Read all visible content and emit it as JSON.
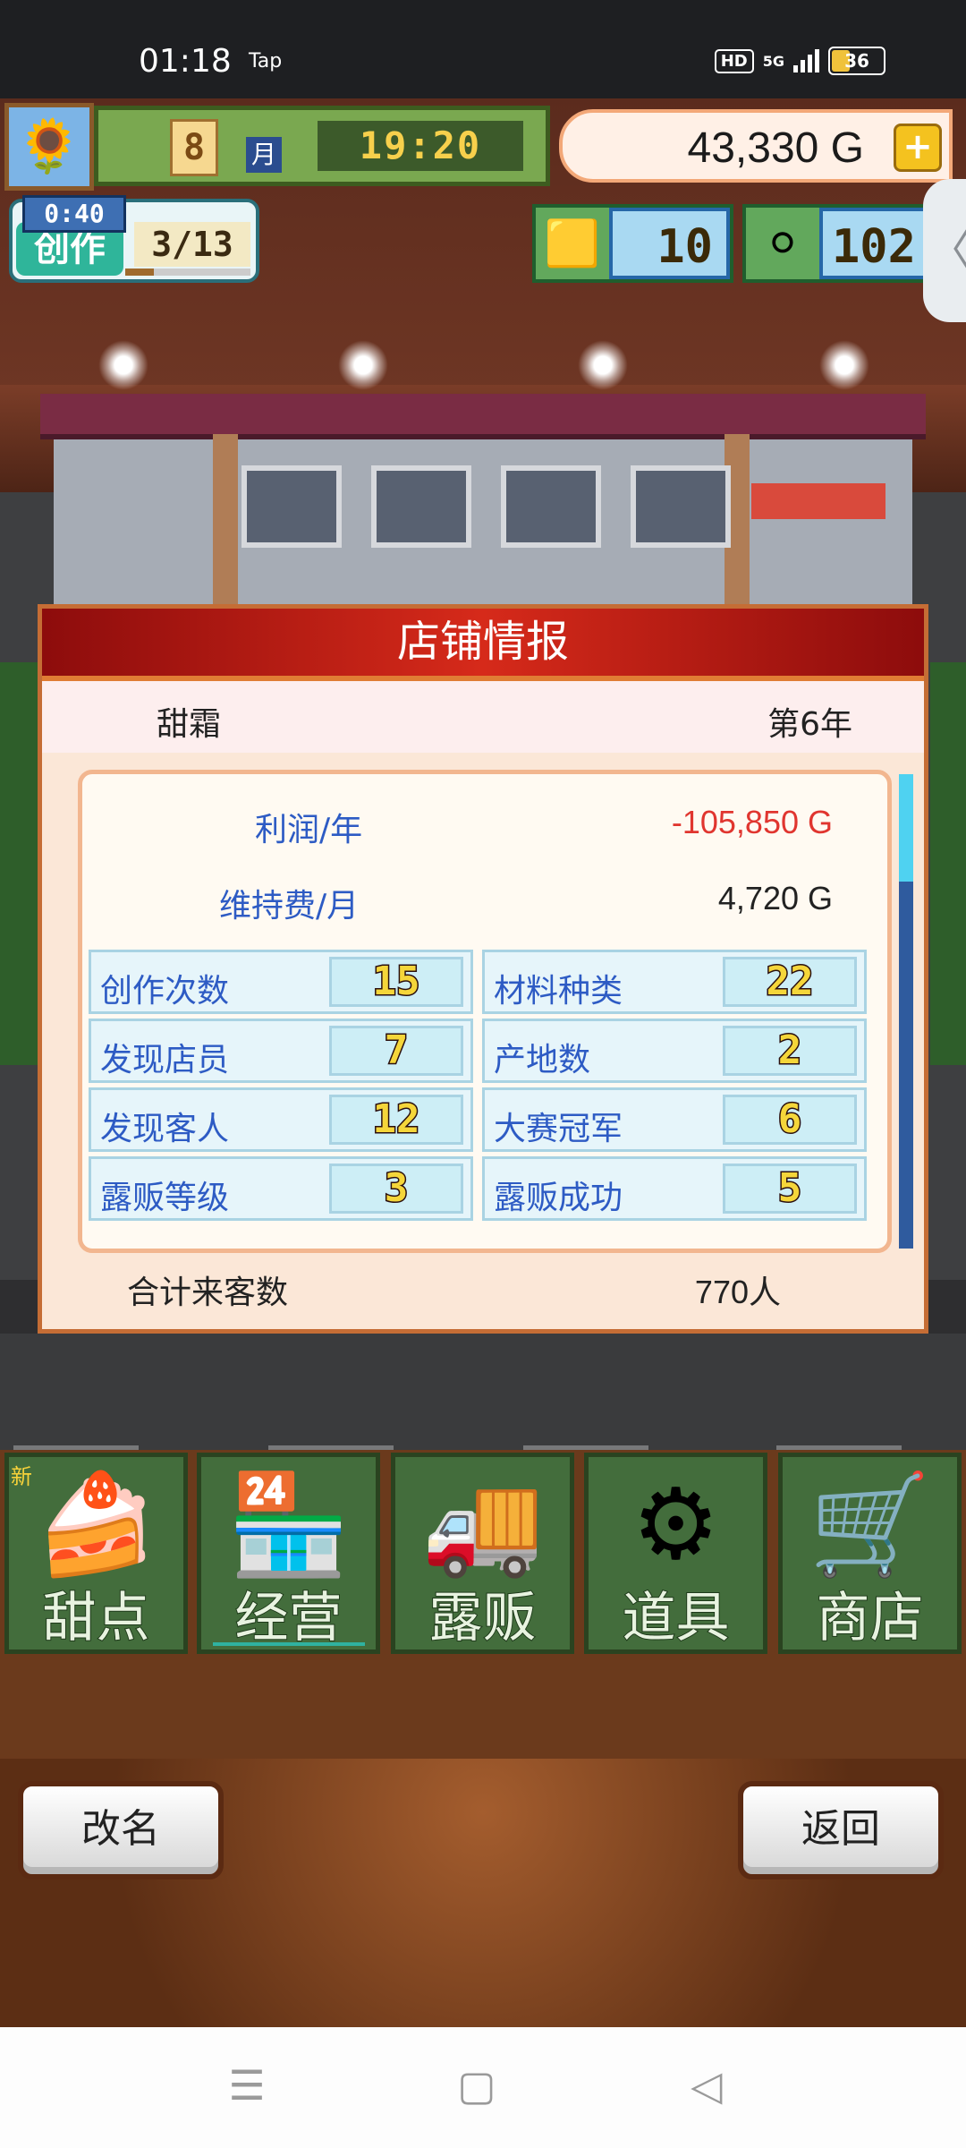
{
  "status_bar": {
    "time": "01:18",
    "carrier_tag": "Tap",
    "hd": "HD",
    "network": "5G",
    "battery": "36"
  },
  "hud": {
    "avatar_icon": "sunflower-icon",
    "month_number": "8",
    "month_label": "月",
    "clock": "19:20",
    "money": "43,330 G",
    "plus_label": "+",
    "create_timer": "0:40",
    "create_label": "创作",
    "create_count": "3/13",
    "create_progress": 0.23,
    "gold_bars": "10",
    "medals": "102",
    "side_tab": "〈"
  },
  "panel": {
    "title": "店铺情报",
    "shop_name": "甜霜",
    "year": "第6年",
    "profit_label": "利润/年",
    "profit_value": "-105,850 G",
    "maintenance_label": "维持费/月",
    "maintenance_value": "4,720 G",
    "stats": [
      {
        "label": "创作次数",
        "value": "15"
      },
      {
        "label": "材料种类",
        "value": "22"
      },
      {
        "label": "发现店员",
        "value": "7"
      },
      {
        "label": "产地数",
        "value": "2"
      },
      {
        "label": "发现客人",
        "value": "12"
      },
      {
        "label": "大赛冠军",
        "value": "6"
      },
      {
        "label": "露贩等级",
        "value": "3"
      },
      {
        "label": "露贩成功",
        "value": "5"
      }
    ],
    "total_label": "合计来客数",
    "total_value": "770人"
  },
  "nav": {
    "new_badge": "新",
    "items": [
      {
        "label": "甜点",
        "icon": "cake-icon",
        "glyph": "🍰"
      },
      {
        "label": "经营",
        "icon": "shop-icon",
        "glyph": "🏪"
      },
      {
        "label": "露贩",
        "icon": "food-truck-icon",
        "glyph": "🚚"
      },
      {
        "label": "道具",
        "icon": "gear-bag-icon",
        "glyph": "⚙"
      },
      {
        "label": "商店",
        "icon": "cart-icon",
        "glyph": "🛒"
      }
    ]
  },
  "buttons": {
    "rename": "改名",
    "back": "返回"
  },
  "system_nav": {
    "menu": "☰",
    "home": "▢",
    "back": "◁"
  }
}
